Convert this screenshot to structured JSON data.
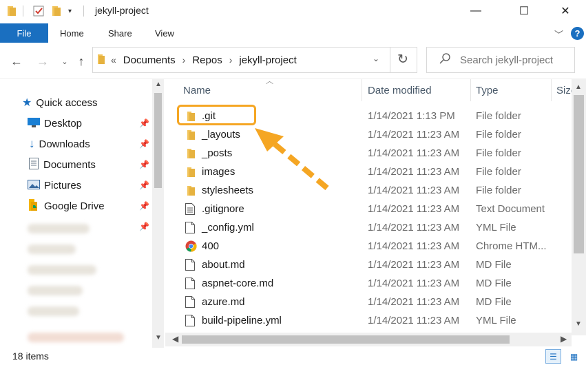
{
  "window": {
    "title": "jekyll-project",
    "minimize": "—",
    "maximize": "☐",
    "close": "✕"
  },
  "ribbon": {
    "file": "File",
    "tabs": [
      "Home",
      "Share",
      "View"
    ],
    "help": "?"
  },
  "address": {
    "crumbs": [
      "Documents",
      "Repos",
      "jekyll-project"
    ],
    "prefix": "«"
  },
  "search": {
    "placeholder": "Search jekyll-project"
  },
  "sidebar": {
    "items": [
      {
        "label": "Quick access",
        "icon": "star-icon",
        "color": "#1a6fc0"
      },
      {
        "label": "Desktop",
        "icon": "desktop-icon",
        "color": "#1a7fd4"
      },
      {
        "label": "Downloads",
        "icon": "download-icon",
        "color": "#1a6fc0"
      },
      {
        "label": "Documents",
        "icon": "documents-icon",
        "color": "#6a7a8a"
      },
      {
        "label": "Pictures",
        "icon": "pictures-icon",
        "color": "#3a6aa0"
      },
      {
        "label": "Google Drive",
        "icon": "google-drive-icon",
        "color": "#f4b400"
      }
    ]
  },
  "columns": {
    "name": "Name",
    "date": "Date modified",
    "type": "Type",
    "size": "Size"
  },
  "files": [
    {
      "name": ".git",
      "date": "1/14/2021 1:13 PM",
      "type": "File folder",
      "kind": "folder"
    },
    {
      "name": "_layouts",
      "date": "1/14/2021 11:23 AM",
      "type": "File folder",
      "kind": "folder"
    },
    {
      "name": "_posts",
      "date": "1/14/2021 11:23 AM",
      "type": "File folder",
      "kind": "folder"
    },
    {
      "name": "images",
      "date": "1/14/2021 11:23 AM",
      "type": "File folder",
      "kind": "folder"
    },
    {
      "name": "stylesheets",
      "date": "1/14/2021 11:23 AM",
      "type": "File folder",
      "kind": "folder"
    },
    {
      "name": ".gitignore",
      "date": "1/14/2021 11:23 AM",
      "type": "Text Document",
      "kind": "text"
    },
    {
      "name": "_config.yml",
      "date": "1/14/2021 11:23 AM",
      "type": "YML File",
      "kind": "file"
    },
    {
      "name": "400",
      "date": "1/14/2021 11:23 AM",
      "type": "Chrome HTM...",
      "kind": "chrome"
    },
    {
      "name": "about.md",
      "date": "1/14/2021 11:23 AM",
      "type": "MD File",
      "kind": "file"
    },
    {
      "name": "aspnet-core.md",
      "date": "1/14/2021 11:23 AM",
      "type": "MD File",
      "kind": "file"
    },
    {
      "name": "azure.md",
      "date": "1/14/2021 11:23 AM",
      "type": "MD File",
      "kind": "file"
    },
    {
      "name": "build-pipeline.yml",
      "date": "1/14/2021 11:23 AM",
      "type": "YML File",
      "kind": "file"
    }
  ],
  "status": {
    "count": "18 items"
  },
  "colors": {
    "accent": "#1a6fc0",
    "highlight": "#f5a623",
    "folder": "#f2c45a"
  }
}
